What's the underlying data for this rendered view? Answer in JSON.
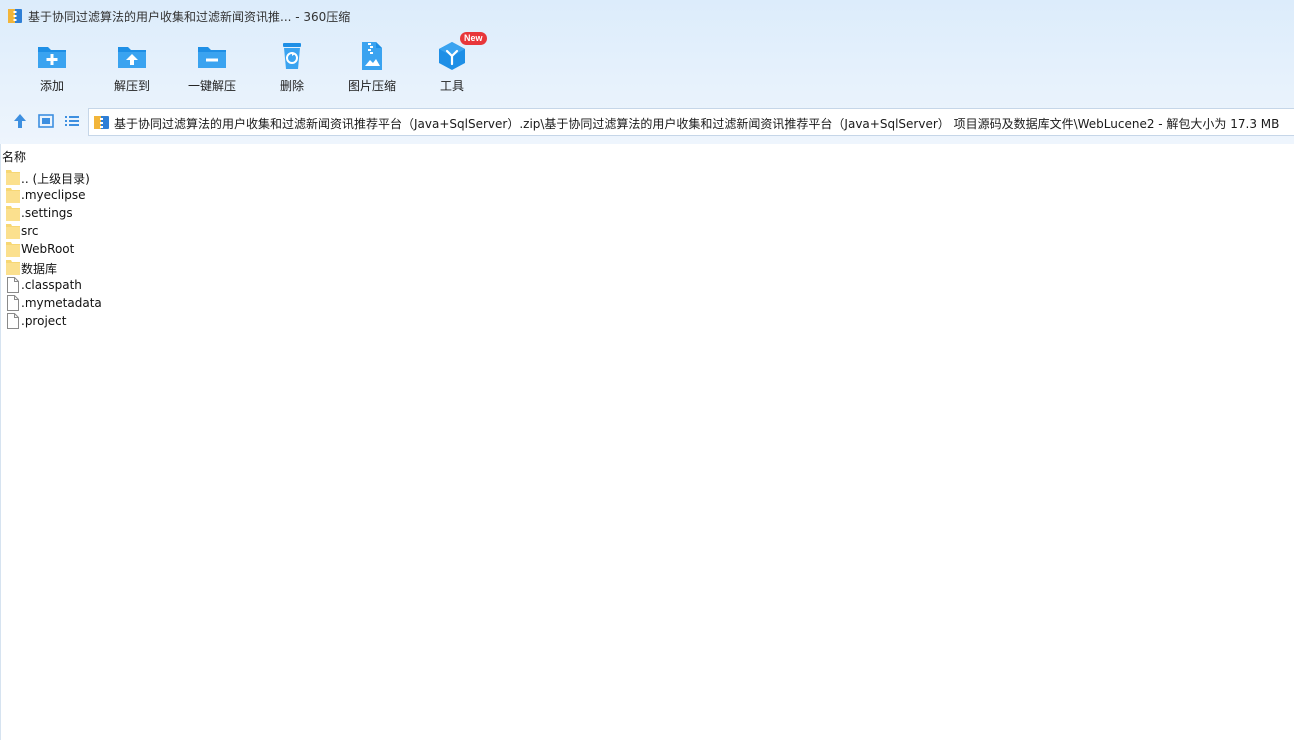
{
  "window": {
    "title": "基于协同过滤算法的用户收集和过滤新闻资讯推... - 360压缩"
  },
  "toolbar": {
    "add_label": "添加",
    "extract_to_label": "解压到",
    "one_click_extract_label": "一键解压",
    "delete_label": "删除",
    "image_compress_label": "图片压缩",
    "tools_label": "工具",
    "tools_badge": "New"
  },
  "pathbar": {
    "path": "基于协同过滤算法的用户收集和过滤新闻资讯推荐平台（Java+SqlServer）.zip\\基于协同过滤算法的用户收集和过滤新闻资讯推荐平台（Java+SqlServer） 项目源码及数据库文件\\WebLucene2 - 解包大小为 17.3 MB"
  },
  "filelist": {
    "column_name": "名称",
    "items": [
      {
        "name": ".. (上级目录)",
        "type": "folder"
      },
      {
        "name": ".myeclipse",
        "type": "folder"
      },
      {
        "name": ".settings",
        "type": "folder"
      },
      {
        "name": "src",
        "type": "folder"
      },
      {
        "name": "WebRoot",
        "type": "folder"
      },
      {
        "name": "数据库",
        "type": "folder"
      },
      {
        "name": ".classpath",
        "type": "file"
      },
      {
        "name": ".mymetadata",
        "type": "file"
      },
      {
        "name": ".project",
        "type": "file"
      }
    ]
  },
  "colors": {
    "accent": "#1e8fe6",
    "folder": "#f7d774",
    "badge": "#e8363a"
  }
}
